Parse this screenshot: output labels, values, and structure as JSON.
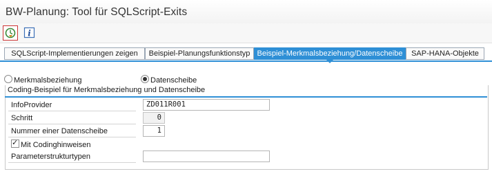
{
  "window": {
    "title": "BW-Planung: Tool für SQLScript-Exits"
  },
  "toolbar": {
    "execute_icon": "clock-execute-icon",
    "info_icon": "info-icon"
  },
  "tabs": [
    {
      "label": "SQLScript-Implementierungen zeigen",
      "active": false
    },
    {
      "label": "Beispiel-Planungsfunktionstyp",
      "active": false
    },
    {
      "label": "Beispiel-Merkmalsbeziehung/Datenscheibe",
      "active": true
    },
    {
      "label": "SAP-HANA-Objekte",
      "active": false
    }
  ],
  "radio": {
    "option1": "Merkmalsbeziehung",
    "option2": "Datenscheibe",
    "selected": "Datenscheibe"
  },
  "group": {
    "title": "Coding-Beispiel für Merkmalsbeziehung und Datenscheibe",
    "fields": {
      "infoprovider_label": "InfoProvider",
      "infoprovider_value": "ZD011R001",
      "schritt_label": "Schritt",
      "schritt_value": "0",
      "datenscheibe_label": "Nummer einer Datenscheibe",
      "datenscheibe_value": "1",
      "codinghinweise_label": "Mit Codinghinweisen",
      "codinghinweise_checked": true,
      "parameter_label": "Parameterstrukturtypen",
      "parameter_value": ""
    }
  },
  "colors": {
    "accent": "#2e8fd6",
    "execute_border": "#cc3333"
  }
}
